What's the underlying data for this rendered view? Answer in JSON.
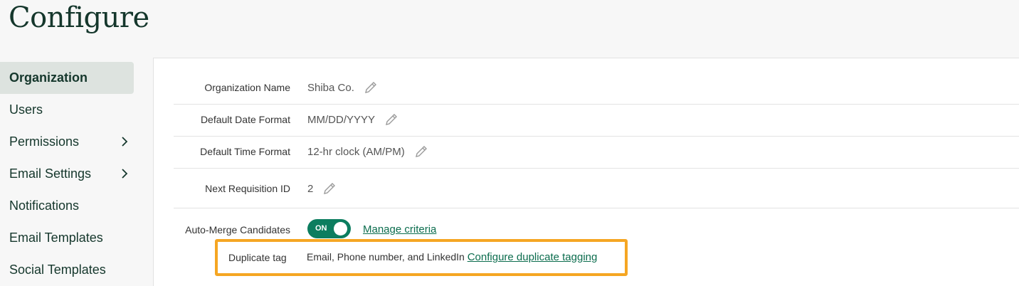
{
  "page": {
    "title": "Configure"
  },
  "sidebar": {
    "items": [
      {
        "label": "Organization"
      },
      {
        "label": "Users"
      },
      {
        "label": "Permissions"
      },
      {
        "label": "Email Settings"
      },
      {
        "label": "Notifications"
      },
      {
        "label": "Email Templates"
      },
      {
        "label": "Social Templates"
      }
    ]
  },
  "settings": {
    "org_name": {
      "label": "Organization Name",
      "value": "Shiba Co."
    },
    "date_format": {
      "label": "Default Date Format",
      "value": "MM/DD/YYYY"
    },
    "time_format": {
      "label": "Default Time Format",
      "value": "12-hr clock (AM/PM)"
    },
    "requisition": {
      "label": "Next Requisition ID",
      "value": "2"
    },
    "auto_merge": {
      "label": "Auto-Merge Candidates",
      "toggle_text": "ON",
      "link": "Manage criteria"
    },
    "duplicate_tag": {
      "label": "Duplicate tag",
      "value": "Email, Phone number, and LinkedIn",
      "link": "Configure duplicate tagging"
    }
  },
  "colors": {
    "accent": "#0c7d5f",
    "highlight": "#f5a623",
    "title": "#15372c"
  },
  "icons": {
    "edit": "pencil-icon",
    "expand": "chevron-right-icon"
  }
}
